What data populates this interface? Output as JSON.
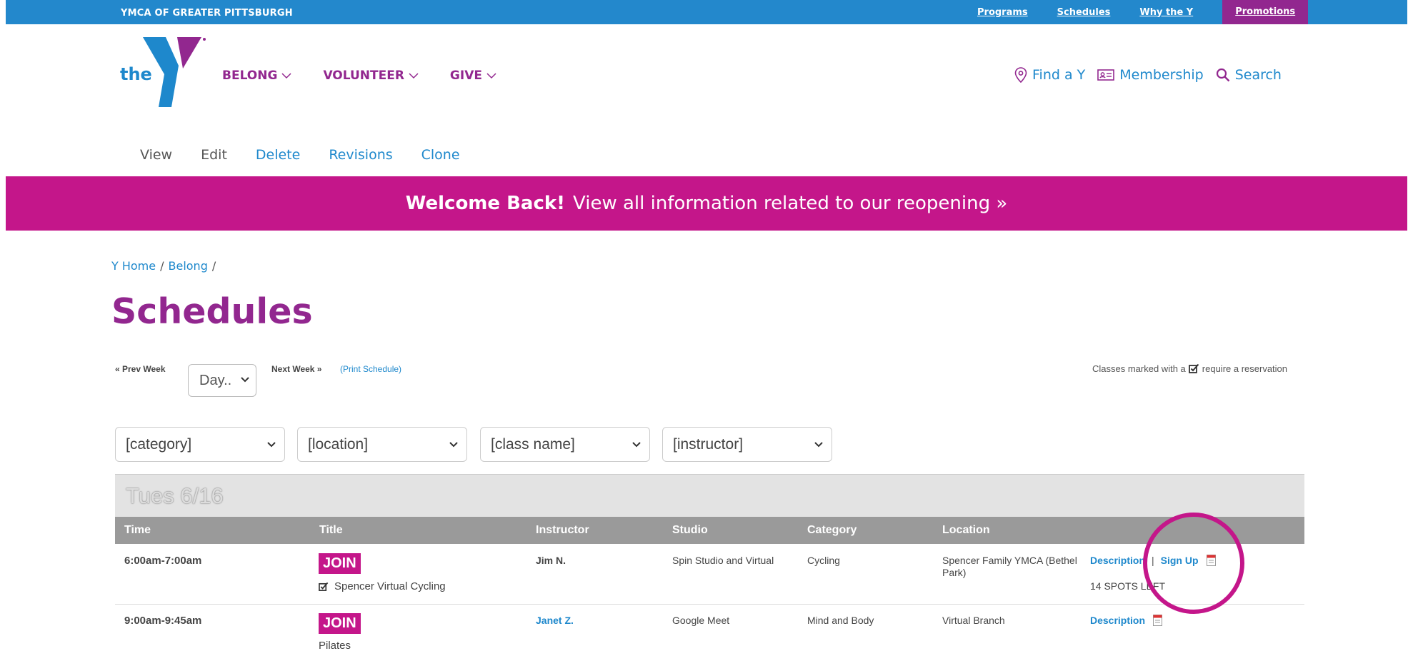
{
  "topbar": {
    "org": "YMCA OF GREATER PITTSBURGH",
    "links": [
      "Programs",
      "Schedules",
      "Why the Y"
    ],
    "promo": "Promotions"
  },
  "header": {
    "logo_text": "the",
    "nav": [
      "BELONG",
      "VOLUNTEER",
      "GIVE"
    ],
    "util": {
      "find": "Find a Y",
      "membership": "Membership",
      "search": "Search"
    }
  },
  "tabs": [
    "View",
    "Edit",
    "Delete",
    "Revisions",
    "Clone"
  ],
  "banner": {
    "bold": "Welcome Back!",
    "text": "View all information related to our reopening »"
  },
  "breadcrumb": [
    "Y Home",
    "Belong"
  ],
  "page_title": "Schedules",
  "controls": {
    "prev": "« Prev Week",
    "day": "Day..",
    "next": "Next Week »",
    "print": "(Print Schedule)",
    "note_before": "Classes marked with a",
    "note_after": "require a reservation"
  },
  "filters": [
    "[category]",
    "[location]",
    "[class name]",
    "[instructor]"
  ],
  "day_header": "Tues 6/16",
  "columns": [
    "Time",
    "Title",
    "Instructor",
    "Studio",
    "Category",
    "Location"
  ],
  "rows": [
    {
      "time": "6:00am-7:00am",
      "join": "JOIN",
      "title": "Spencer Virtual Cycling",
      "instructor": "Jim N.",
      "studio": "Spin Studio and Virtual",
      "category": "Cycling",
      "location": "Spencer Family YMCA (Bethel Park)",
      "description": "Description",
      "sep": "|",
      "signup": "Sign Up",
      "spots": "14 SPOTS LEFT"
    },
    {
      "time": "9:00am-9:45am",
      "join": "JOIN",
      "title": "Pilates",
      "instructor": "Janet Z.",
      "studio": "Google Meet",
      "category": "Mind and Body",
      "location": "Virtual Branch",
      "description": "Description"
    }
  ],
  "colors": {
    "blue": "#2388cc",
    "purple": "#92278f",
    "magenta": "#c4168a"
  }
}
